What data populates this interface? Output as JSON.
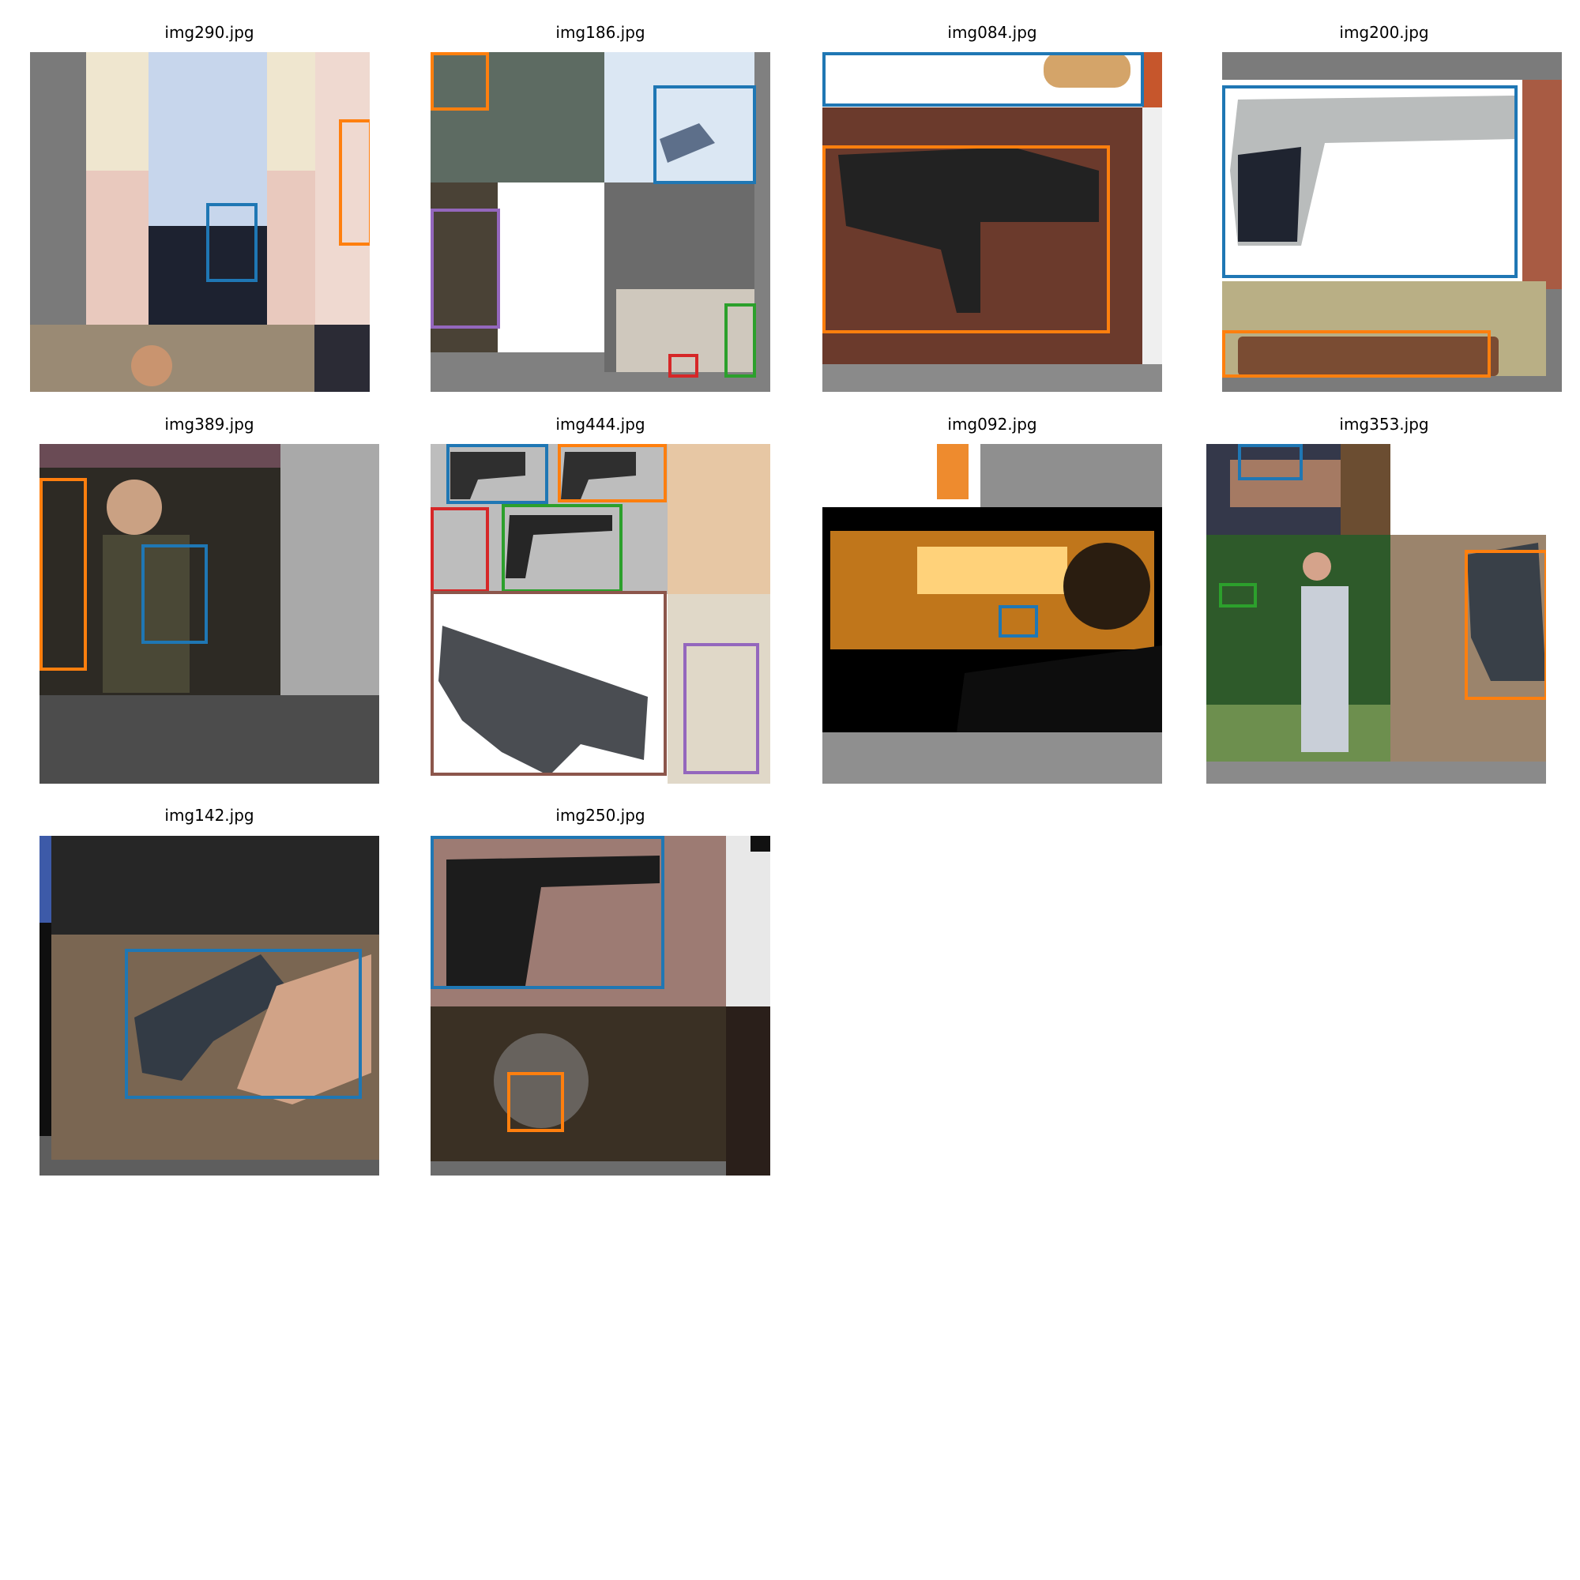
{
  "page": {
    "background": "#ffffff"
  },
  "tiles": [
    {
      "title": "img290.jpg"
    },
    {
      "title": "img186.jpg"
    },
    {
      "title": "img084.jpg"
    },
    {
      "title": "img200.jpg"
    },
    {
      "title": "img389.jpg"
    },
    {
      "title": "img444.jpg"
    },
    {
      "title": "img092.jpg"
    },
    {
      "title": "img353.jpg"
    },
    {
      "title": "img142.jpg"
    },
    {
      "title": "img250.jpg"
    }
  ],
  "box_colors": {
    "blue": "#1f77b4",
    "orange": "#ff7f0e",
    "green": "#2ca02c",
    "red": "#d62728",
    "purple": "#9467bd",
    "brown": "#8c564b"
  },
  "icons": [
    "pistol-image",
    "photo-collage-tile"
  ]
}
